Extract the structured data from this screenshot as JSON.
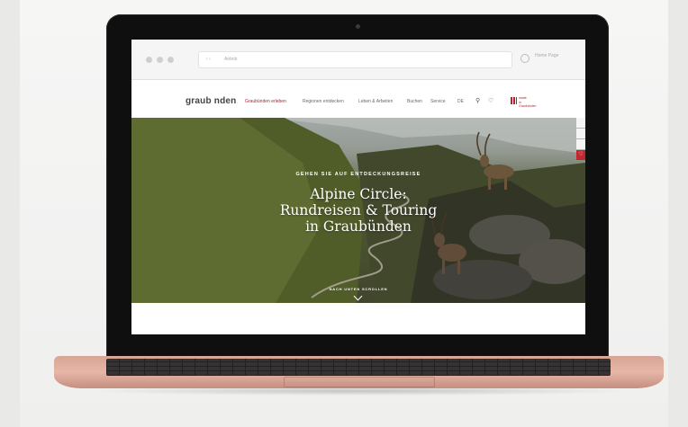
{
  "browser": {
    "address_text": "Airbnb",
    "nav_arrows": "‹  ›",
    "home_label": "Home Page"
  },
  "site": {
    "logo": "graub nden",
    "nav": [
      {
        "label": "Graubünden erleben"
      },
      {
        "label": "Regionen entdecken"
      },
      {
        "label": "Leben & Arbeiten"
      },
      {
        "label": "Buchen"
      },
      {
        "label": "Service"
      },
      {
        "label": "DE"
      }
    ],
    "brand_mark_line1": "made",
    "brand_mark_line2": "in Graubünden"
  },
  "hero": {
    "overline": "GEHEN SIE AUF ENTDECKUNGSREISE",
    "title_line1": "Alpine Circle:",
    "title_line2": "Rundreisen & Touring",
    "title_line3": "in Graubünden",
    "scroll_hint": "NACH UNTEN SCROLLEN"
  },
  "colors": {
    "brand": "#b3252f",
    "laptop_body": "#e6b6a7",
    "bezel": "#0f0f10"
  }
}
